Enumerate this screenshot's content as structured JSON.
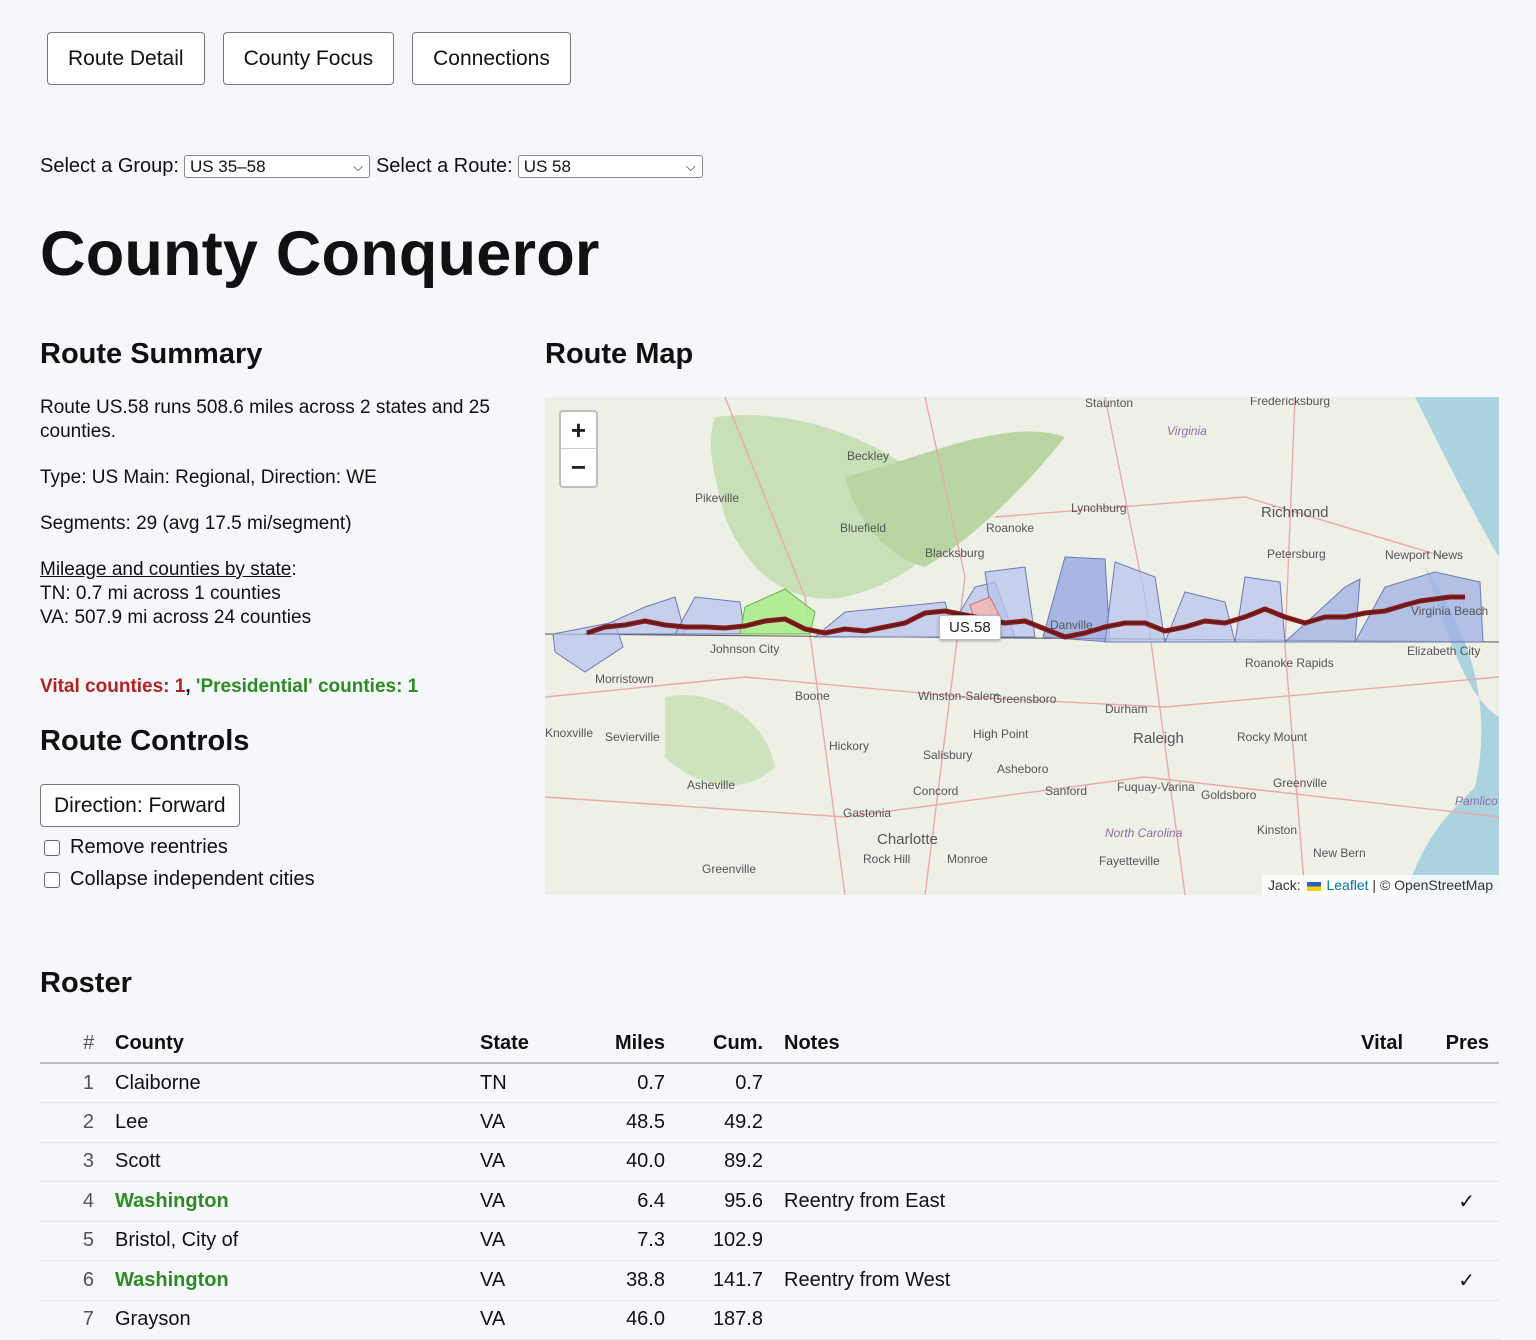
{
  "tabs": [
    "Route Detail",
    "County Focus",
    "Connections"
  ],
  "selectors": {
    "group_label": "Select a Group:",
    "group_value": "US 35–58",
    "route_label": "Select a Route:",
    "route_value": "US 58"
  },
  "title": "County Conqueror",
  "summary": {
    "heading": "Route Summary",
    "line1": "Route US.58 runs 508.6 miles across 2 states and 25 counties.",
    "line2": "Type: US Main: Regional, Direction: WE",
    "line3": "Segments: 29 (avg 17.5 mi/segment)",
    "by_state_label": "Mileage and counties by state",
    "by_state_colon": ":",
    "states": [
      "TN: 0.7 mi across 1 counties",
      "VA: 507.9 mi across 24 counties"
    ],
    "vital": "Vital counties: 1",
    "sep": ", ",
    "pres": "'Presidential' counties: 1"
  },
  "controls": {
    "heading": "Route Controls",
    "direction_button": "Direction: Forward",
    "remove_reentries": "Remove reentries",
    "collapse_cities": "Collapse independent cities"
  },
  "map": {
    "heading": "Route Map",
    "route_label": "US.58",
    "zoom_in": "+",
    "zoom_out": "−",
    "attribution_leaflet": "Leaflet",
    "attribution_rest": " | © OpenStreetMap",
    "attribution_prefix": "Jack:",
    "places": [
      "Staunton",
      "Fredericksburg",
      "Virginia",
      "Beckley",
      "Pikeville",
      "Richmond",
      "Lynchburg",
      "Bluefield",
      "Roanoke",
      "Blacksburg",
      "Petersburg",
      "Newport News",
      "Danville",
      "Virginia Beach",
      "Elizabeth City",
      "Johnson City",
      "Morristown",
      "Boone",
      "Winston-Salem",
      "Greensboro",
      "Durham",
      "Roanoke Rapids",
      "Knoxville",
      "Sevierville",
      "Raleigh",
      "Rocky Mount",
      "Hickory",
      "High Point",
      "Salisbury",
      "Asheboro",
      "Asheville",
      "Concord",
      "Sanford",
      "Fuquay-Varina",
      "Goldsboro",
      "Greenville",
      "Gastonia",
      "Charlotte",
      "North Carolina",
      "Kinston",
      "Rock Hill",
      "Monroe",
      "Fayetteville",
      "New Bern",
      "Pamlico Sound",
      "Greenville"
    ],
    "colors": {
      "route": "#8b1a1a",
      "county_fill": "#b8c4ec",
      "pres_fill": "#a8ec8c",
      "vital_fill": "#f2b8b8"
    }
  },
  "roster": {
    "heading": "Roster",
    "columns": [
      "#",
      "County",
      "State",
      "Miles",
      "Cum.",
      "Notes",
      "Vital",
      "Pres"
    ],
    "rows": [
      {
        "n": "1",
        "county": "Claiborne",
        "state": "TN",
        "miles": "0.7",
        "cum": "0.7",
        "notes": "",
        "vital": "",
        "pres": "",
        "pres_flag": false
      },
      {
        "n": "2",
        "county": "Lee",
        "state": "VA",
        "miles": "48.5",
        "cum": "49.2",
        "notes": "",
        "vital": "",
        "pres": "",
        "pres_flag": false
      },
      {
        "n": "3",
        "county": "Scott",
        "state": "VA",
        "miles": "40.0",
        "cum": "89.2",
        "notes": "",
        "vital": "",
        "pres": "",
        "pres_flag": false
      },
      {
        "n": "4",
        "county": "Washington",
        "state": "VA",
        "miles": "6.4",
        "cum": "95.6",
        "notes": "Reentry from East",
        "vital": "",
        "pres": "✓",
        "pres_flag": true
      },
      {
        "n": "5",
        "county": "Bristol, City of",
        "state": "VA",
        "miles": "7.3",
        "cum": "102.9",
        "notes": "",
        "vital": "",
        "pres": "",
        "pres_flag": false
      },
      {
        "n": "6",
        "county": "Washington",
        "state": "VA",
        "miles": "38.8",
        "cum": "141.7",
        "notes": "Reentry from West",
        "vital": "",
        "pres": "✓",
        "pres_flag": true
      },
      {
        "n": "7",
        "county": "Grayson",
        "state": "VA",
        "miles": "46.0",
        "cum": "187.8",
        "notes": "",
        "vital": "",
        "pres": "",
        "pres_flag": false
      }
    ]
  }
}
